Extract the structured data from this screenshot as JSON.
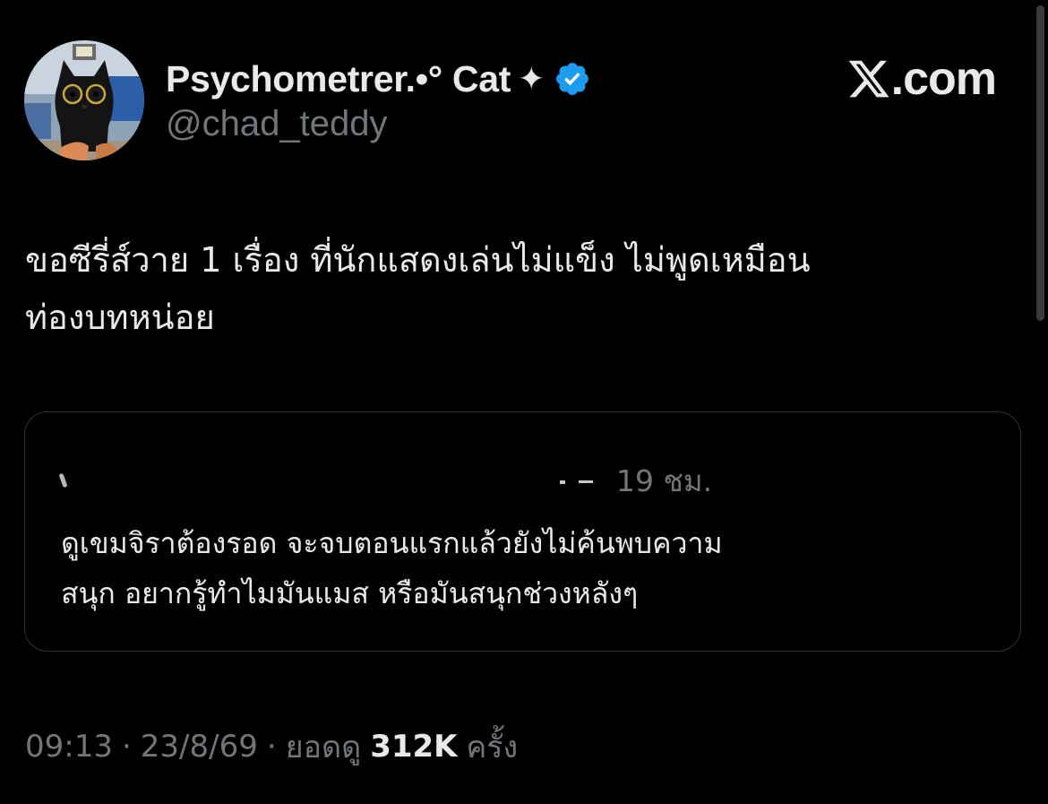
{
  "author": {
    "display_name": "Psychometrer.•° Cat",
    "sparkle_glyph": "✦",
    "handle": "@chad_teddy",
    "verified_color": "#1d9bf0"
  },
  "brand": {
    "logo_icon": "x-logo-icon",
    "text": ".com"
  },
  "tweet": {
    "text_lines": [
      "ขอซีรี่ส์วาย 1 เรื่อง ที่นักแสดงเล่นไม่แข็ง ไม่พูดเหมือน",
      "ท่องบทหน่อย"
    ]
  },
  "quoted_tweet": {
    "time": "19 ชม.",
    "text_lines": [
      "ดูเขมจิราต้องรอด จะจบตอนแรกแล้วยังไม่ค้นพบความ",
      "สนุก อยากรู้ทำไมมันแมส หรือมันสนุกช่วงหลังๆ"
    ]
  },
  "meta": {
    "time": "09:13",
    "separator": "·",
    "date": "23/8/69",
    "views_label": "ยอดดู",
    "views_count": "312K",
    "views_unit": "ครั้ง"
  },
  "colors": {
    "background": "#000000",
    "text_primary": "#e7e9ea",
    "text_secondary": "#71767b",
    "card_border": "#2f3336"
  }
}
